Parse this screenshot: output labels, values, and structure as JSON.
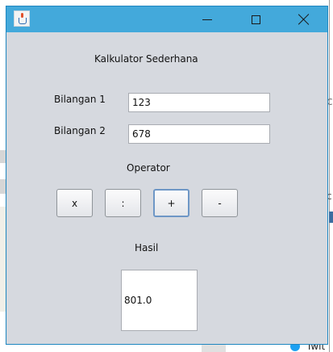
{
  "window": {
    "title": ""
  },
  "form": {
    "title": "Kalkulator Sederhana",
    "bilangan1_label": "Bilangan 1",
    "bilangan1_value": "123",
    "bilangan2_label": "Bilangan 2",
    "bilangan2_value": "678",
    "operator_label": "Operator",
    "operators": {
      "multiply": "x",
      "divide": ":",
      "add": "+",
      "subtract": "-"
    },
    "result_label": "Hasil",
    "result_value": "801.0"
  },
  "background": {
    "right_fragment_1": "c",
    "right_fragment_2": "c",
    "bottom_text": "Twit"
  },
  "colors": {
    "titlebar": "#43a9db",
    "window_body": "#d6d9df",
    "focus_border": "#6e97c6"
  }
}
